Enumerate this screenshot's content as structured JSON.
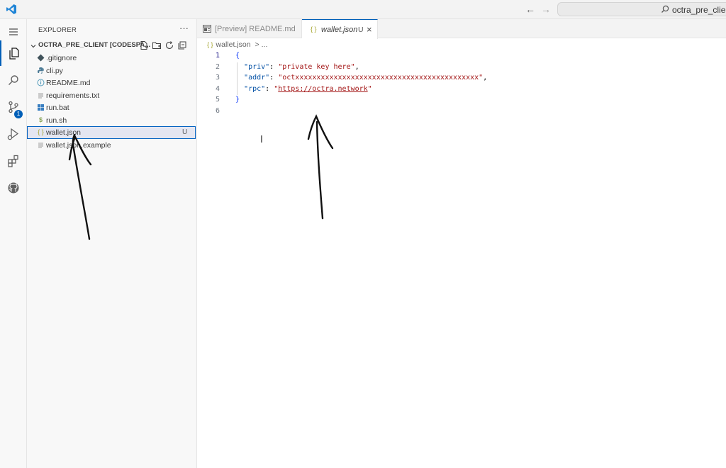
{
  "titlebar": {
    "title": "octra_pre_client [C",
    "back_icon": "arrow-left-icon",
    "forward_icon": "arrow-right-icon"
  },
  "activity_bar": {
    "items": [
      {
        "name": "menu-icon"
      },
      {
        "name": "explorer-icon"
      },
      {
        "name": "search-icon"
      },
      {
        "name": "source-control-icon",
        "badge": "1"
      },
      {
        "name": "run-debug-icon"
      },
      {
        "name": "extensions-icon"
      },
      {
        "name": "github-icon"
      }
    ]
  },
  "sidebar": {
    "title": "EXPLORER",
    "more": "···",
    "workspace": "OCTRA_PRE_CLIENT [CODESPA...",
    "files": [
      {
        "name": ".gitignore",
        "icon": "gitignore-icon",
        "icon_color": "#41535b"
      },
      {
        "name": "cli.py",
        "icon": "python-icon",
        "icon_color": "#4b7a95"
      },
      {
        "name": "README.md",
        "icon": "info-icon",
        "icon_color": "#519aba"
      },
      {
        "name": "requirements.txt",
        "icon": "text-file-icon",
        "icon_color": "#a0a0a0"
      },
      {
        "name": "run.bat",
        "icon": "windows-icon",
        "icon_color": "#3a7fc1"
      },
      {
        "name": "run.sh",
        "icon": "shell-icon",
        "icon_color": "#89a55a"
      },
      {
        "name": "wallet.json",
        "icon": "json-icon",
        "icon_color": "#a3a32a",
        "status": "U",
        "selected": true
      },
      {
        "name": "wallet.json.example",
        "icon": "text-file-icon",
        "icon_color": "#a0a0a0"
      }
    ]
  },
  "tabs": [
    {
      "label": "[Preview] README.md",
      "icon": "preview-icon"
    },
    {
      "label": "wallet.json",
      "icon": "json-icon",
      "status": "U",
      "active": true
    }
  ],
  "breadcrumb": {
    "file": "wallet.json",
    "sep": ">",
    "more": "..."
  },
  "editor": {
    "lines": [
      {
        "n": "1",
        "text": "{"
      },
      {
        "n": "2",
        "key": "\"priv\"",
        "value": "\"private key here\"",
        "trail": ","
      },
      {
        "n": "3",
        "key": "\"addr\"",
        "value": "\"octxxxxxxxxxxxxxxxxxxxxxxxxxxxxxxxxxxxxxxxxxxx\"",
        "trail": ","
      },
      {
        "n": "4",
        "key": "\"rpc\"",
        "value_pre": "\"",
        "value_link": "https://octra.network",
        "value_post": "\""
      },
      {
        "n": "5",
        "text": "}"
      },
      {
        "n": "6",
        "text": ""
      }
    ]
  },
  "colors": {
    "accent": "#005fb8",
    "selected_row": "#e4e6f1",
    "string": "#a31515",
    "key": "#0451a5"
  }
}
